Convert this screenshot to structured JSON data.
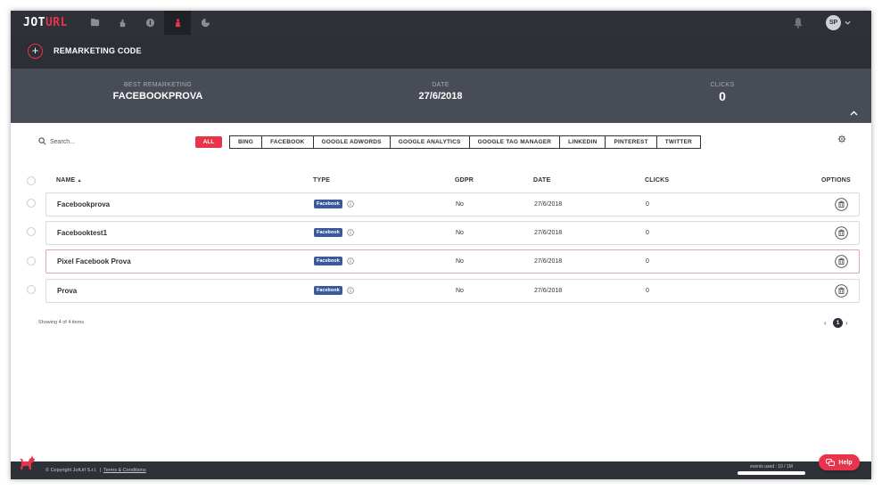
{
  "app": {
    "logo_left": "JOT",
    "logo_right": "URL"
  },
  "header": {
    "title": "REMARKETING CODE"
  },
  "user": {
    "initials": "SP"
  },
  "stats": [
    {
      "label": "BEST REMARKETING",
      "value": "FACEBOOKPROVA"
    },
    {
      "label": "DATE",
      "value": "27/6/2018"
    },
    {
      "label": "CLICKS",
      "value": "0"
    }
  ],
  "search": {
    "placeholder": "Search..."
  },
  "filters": {
    "all": "ALL",
    "items": [
      "BING",
      "FACEBOOK",
      "GOOGLE ADWORDS",
      "GOOGLE ANALYTICS",
      "GOOGLE TAG MANAGER",
      "LINKEDIN",
      "PINTEREST",
      "TWITTER"
    ]
  },
  "table": {
    "columns": {
      "name": "NAME",
      "type": "TYPE",
      "gdpr": "GDPR",
      "date": "DATE",
      "clicks": "CLICKS",
      "options": "OPTIONS"
    },
    "rows": [
      {
        "name": "Facebookprova",
        "type": "Facebook",
        "gdpr": "No",
        "date": "27/6/2018",
        "clicks": "0"
      },
      {
        "name": "Facebooktest1",
        "type": "Facebook",
        "gdpr": "No",
        "date": "27/6/2018",
        "clicks": "0"
      },
      {
        "name": "Pixel Facebook Prova",
        "type": "Facebook",
        "gdpr": "No",
        "date": "27/6/2018",
        "clicks": "0"
      },
      {
        "name": "Prova",
        "type": "Facebook",
        "gdpr": "No",
        "date": "27/6/2018",
        "clicks": "0"
      }
    ]
  },
  "pagination": {
    "summary": "Showing 4 of 4 items",
    "current": "1",
    "prev": "‹",
    "next": "›"
  },
  "footer": {
    "copyright": "© Copyright JotUrl S.r.l.",
    "separator": "|",
    "terms": "Terms & Conditions",
    "events": "events used : 10 / 1M"
  },
  "help": {
    "label": "Help"
  },
  "colors": {
    "accent": "#e8334a",
    "dark": "#2e3138",
    "facebook": "#3b5998"
  }
}
